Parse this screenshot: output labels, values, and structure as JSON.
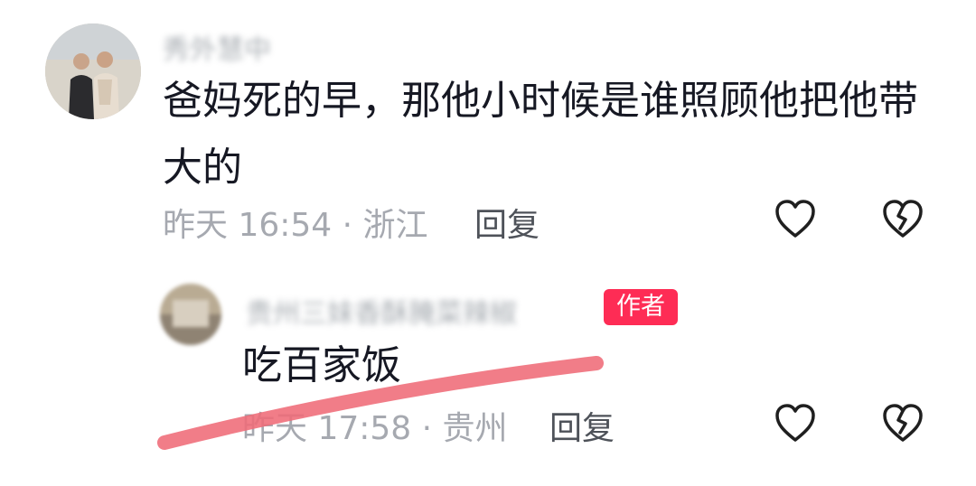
{
  "comment": {
    "username": "秀外慧中",
    "text": "爸妈死的早，那他小时候是谁照顾他把他带大的",
    "time": "昨天 16:54",
    "location": "浙江",
    "reply_label": "回复"
  },
  "reply": {
    "username": "贵州三妹香酥腌菜辣椒",
    "author_badge": "作者",
    "text": "吃百家饭",
    "time": "昨天 17:58",
    "location": "贵州",
    "reply_label": "回复"
  },
  "meta_separator": " · ",
  "icons": {
    "like": "heart-outline-icon",
    "dislike": "broken-heart-icon"
  },
  "colors": {
    "badge": "#fe2c55",
    "meta": "#a6a9b0",
    "scribble": "#ef6b78"
  }
}
